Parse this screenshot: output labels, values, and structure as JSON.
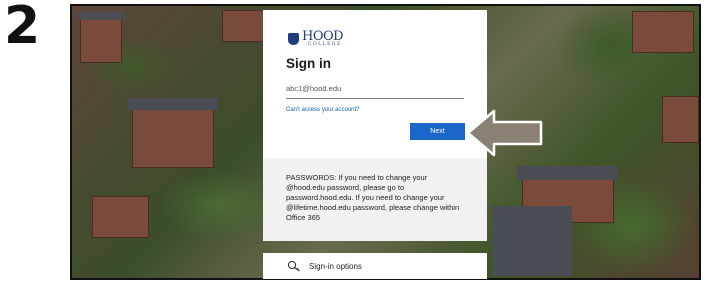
{
  "step_number": "2",
  "brand": {
    "name": "HOOD",
    "subtitle": "COLLEGE"
  },
  "signin": {
    "title": "Sign in",
    "email_value": "abc1@hood.edu",
    "cant_access_link": "Can't access your account?",
    "next_label": "Next"
  },
  "notice": {
    "text": "PASSWORDS: If you need to change your @hood.edu password, please go to password.hood.edu. If you need to change your @lifetime.hood.edu password, please change within Office 365"
  },
  "signin_options": {
    "label": "Sign-in options",
    "icon": "key-search-icon"
  },
  "colors": {
    "accent": "#1b67c9",
    "link": "#0f5fb0",
    "brand": "#1f3d7a",
    "arrow": "#8a8074"
  }
}
